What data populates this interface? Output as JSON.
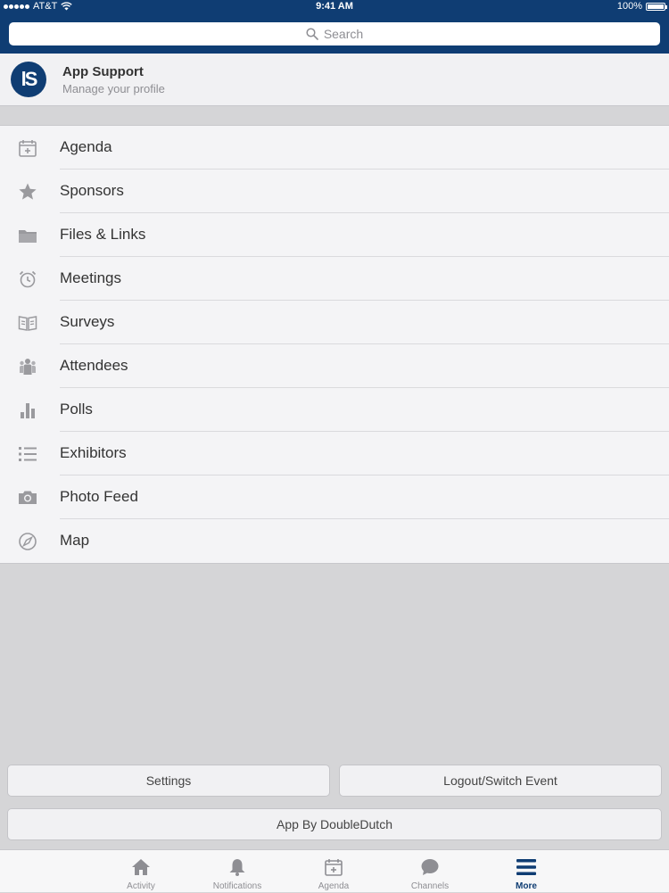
{
  "status_bar": {
    "carrier": "AT&T",
    "time": "9:41 AM",
    "battery": "100%"
  },
  "search": {
    "placeholder": "Search"
  },
  "profile": {
    "avatar_text": "lS",
    "name": "App Support",
    "subtitle": "Manage your profile"
  },
  "menu": {
    "items": [
      {
        "label": "Agenda",
        "icon": "calendar-icon"
      },
      {
        "label": "Sponsors",
        "icon": "star-icon"
      },
      {
        "label": "Files & Links",
        "icon": "folder-icon"
      },
      {
        "label": "Meetings",
        "icon": "alarm-clock-icon"
      },
      {
        "label": "Surveys",
        "icon": "book-icon"
      },
      {
        "label": "Attendees",
        "icon": "people-icon"
      },
      {
        "label": "Polls",
        "icon": "bar-chart-icon"
      },
      {
        "label": "Exhibitors",
        "icon": "list-icon"
      },
      {
        "label": "Photo Feed",
        "icon": "camera-icon"
      },
      {
        "label": "Map",
        "icon": "compass-icon"
      }
    ]
  },
  "buttons": {
    "settings": "Settings",
    "logout": "Logout/Switch Event",
    "app_by": "App By DoubleDutch"
  },
  "tab_bar": {
    "tabs": [
      {
        "label": "Activity",
        "icon": "home-icon"
      },
      {
        "label": "Notifications",
        "icon": "bell-icon"
      },
      {
        "label": "Agenda",
        "icon": "calendar-icon"
      },
      {
        "label": "Channels",
        "icon": "chat-bubble-icon"
      },
      {
        "label": "More",
        "icon": "hamburger-menu-icon"
      }
    ],
    "active": "More"
  },
  "colors": {
    "brand": "#0f3d73",
    "icon_gray": "#9a9a9e",
    "background": "#d5d5d7"
  }
}
